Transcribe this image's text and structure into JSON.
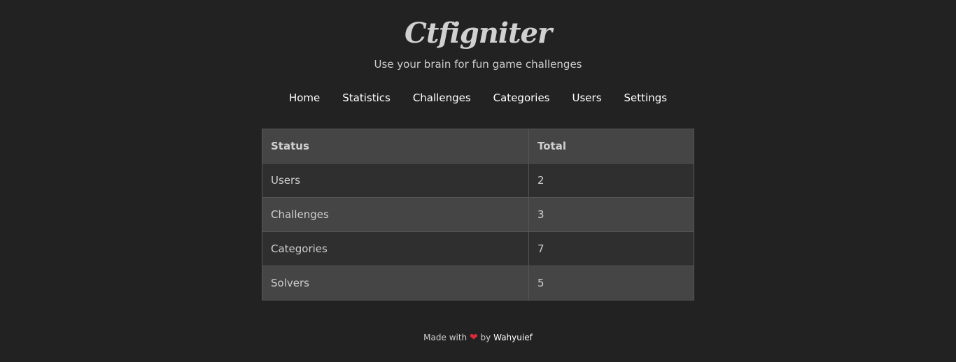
{
  "header": {
    "title": "Ctfigniter",
    "tagline": "Use your brain for fun game challenges"
  },
  "nav": {
    "items": [
      {
        "label": "Home"
      },
      {
        "label": "Statistics"
      },
      {
        "label": "Challenges"
      },
      {
        "label": "Categories"
      },
      {
        "label": "Users"
      },
      {
        "label": "Settings"
      }
    ]
  },
  "table": {
    "headers": [
      "Status",
      "Total"
    ],
    "rows": [
      {
        "status": "Users",
        "total": "2"
      },
      {
        "status": "Challenges",
        "total": "3"
      },
      {
        "status": "Categories",
        "total": "7"
      },
      {
        "status": "Solvers",
        "total": "5"
      }
    ]
  },
  "footer": {
    "made_with": "Made with",
    "heart_icon": "heart-icon",
    "by": "by",
    "author": "Wahyuief"
  },
  "colors": {
    "background": "#222222",
    "heart": "#e0293a"
  }
}
